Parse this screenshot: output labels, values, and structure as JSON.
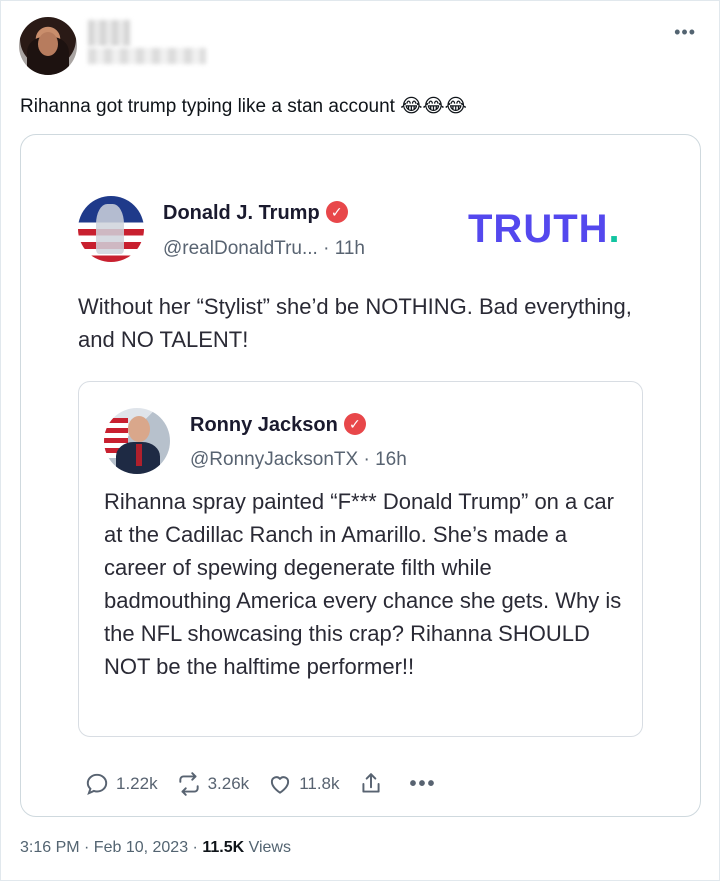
{
  "post": {
    "text": "Rihanna got trump typing like a stan account 😂😂😂",
    "more_icon": "•••",
    "timestamp": "3:16 PM · Feb 10, 2023 · ",
    "views_count": "11.5K",
    "views_label": " Views"
  },
  "embedded": {
    "author_name": "Donald J. Trump",
    "author_handle": "@realDonaldTru...",
    "time": " · 11h",
    "logo_text": "TRUTH",
    "logo_dot": ".",
    "body": "Without her “Stylist” she’d be NOTHING. Bad everything, and NO TALENT!",
    "quoted": {
      "author_name": "Ronny Jackson",
      "author_handle": "@RonnyJacksonTX",
      "time": " · 16h",
      "body": "Rihanna spray painted “F*** Donald Trump” on a car at the Cadillac Ranch in Amarillo. She’s made a career of spewing degenerate filth while badmouthing America every chance she gets. Why is the NFL showcasing this crap? Rihanna SHOULD NOT be the halftime performer!!"
    },
    "actions": {
      "replies": "1.22k",
      "retruths": "3.26k",
      "likes": "11.8k",
      "more": "•••"
    }
  },
  "colors": {
    "truth_purple": "#5448ee",
    "truth_dot": "#12c4a0",
    "verified_badge": "#e8474a",
    "secondary_text": "#536471"
  }
}
